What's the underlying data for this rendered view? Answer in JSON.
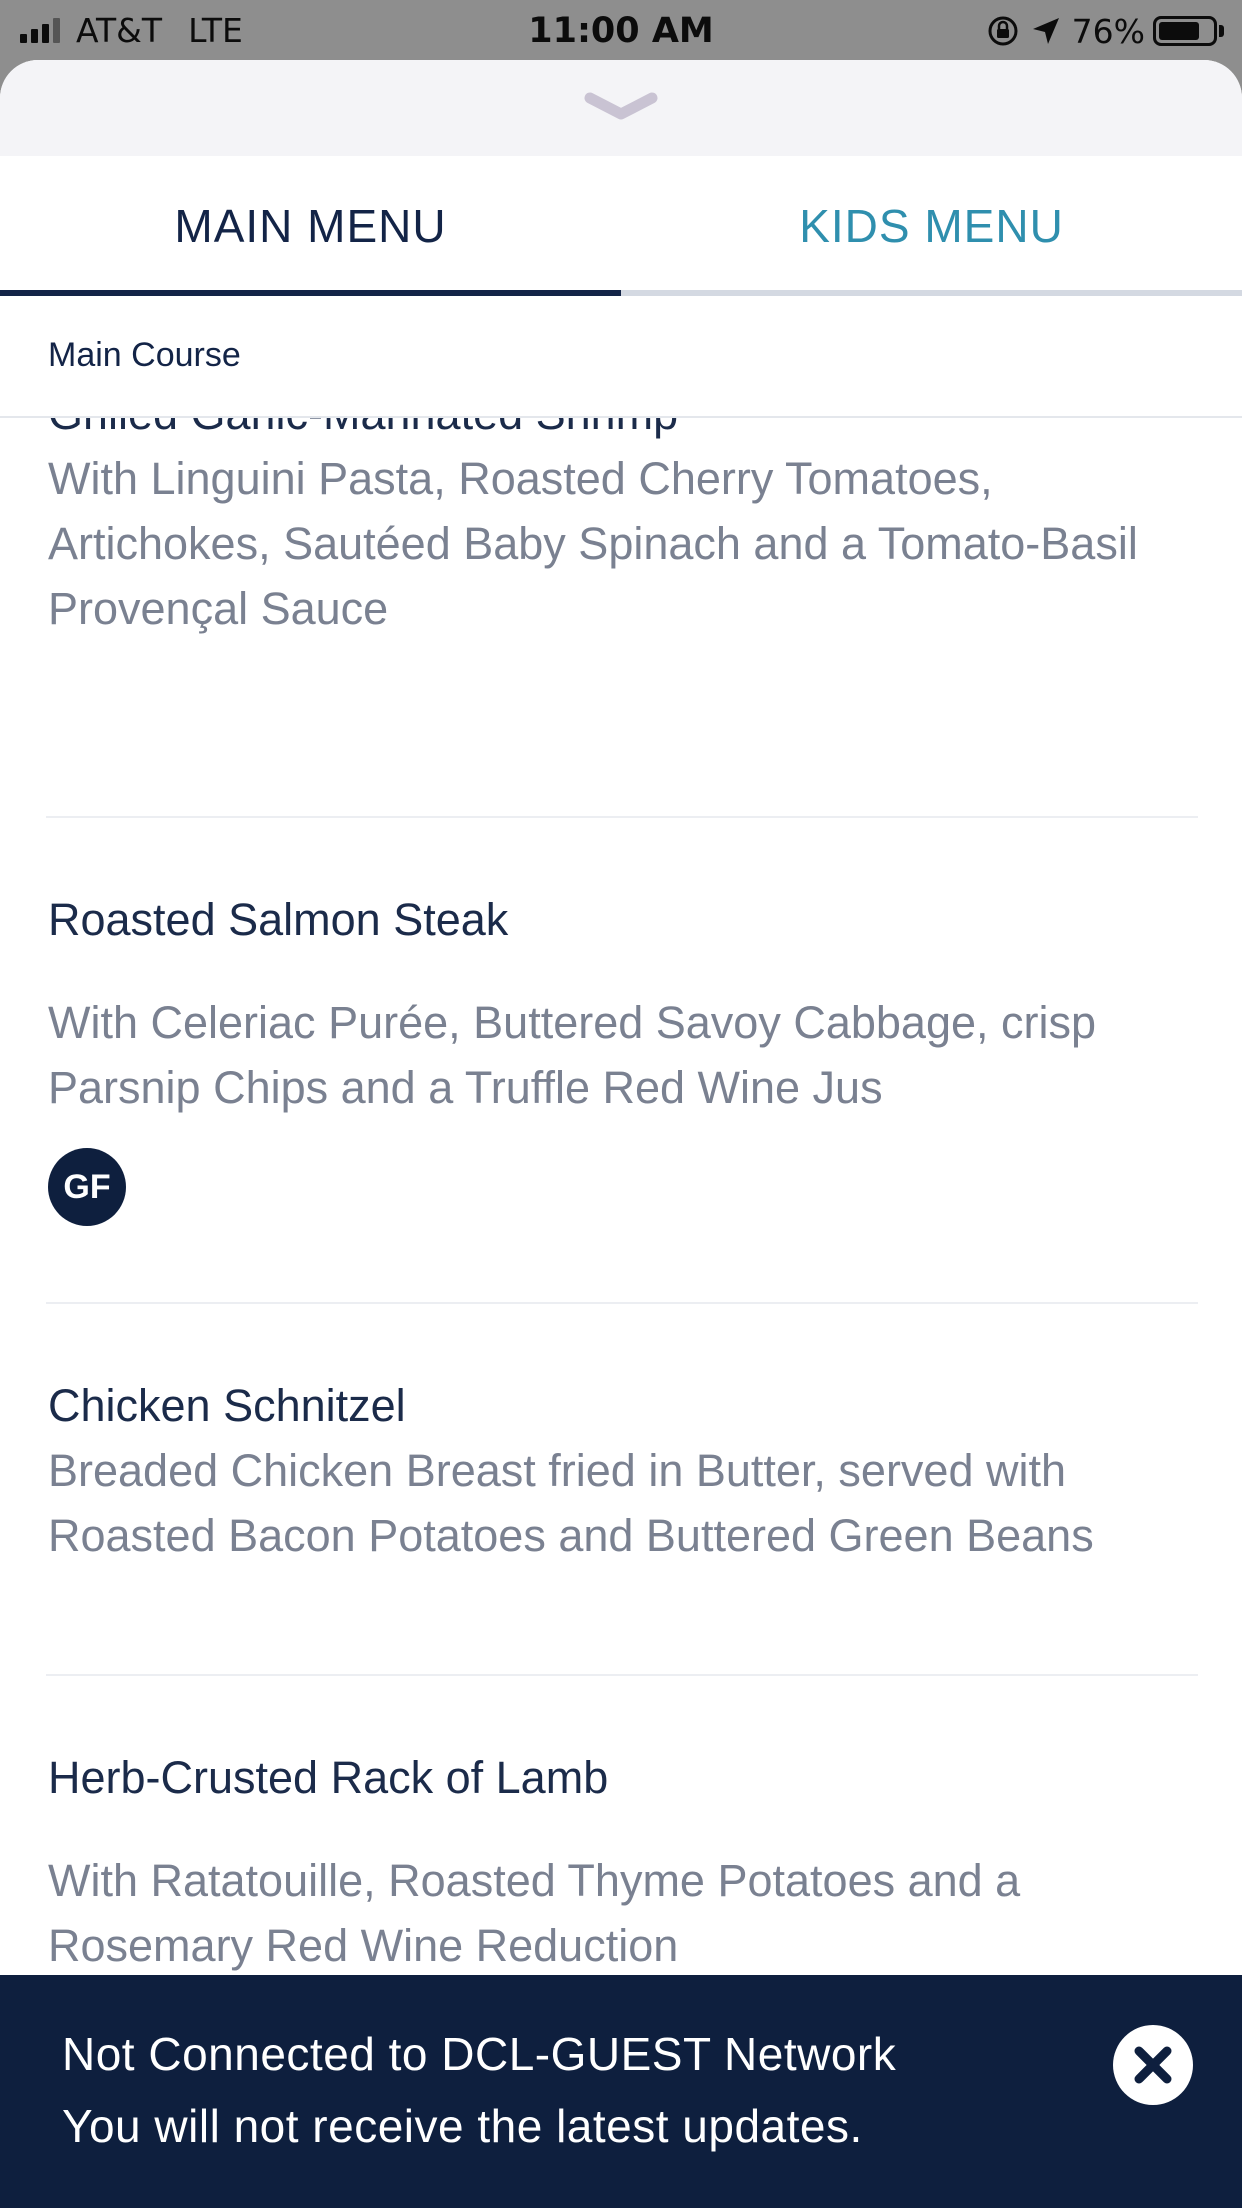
{
  "status_bar": {
    "carrier": "AT&T",
    "network": "LTE",
    "time": "11:00 AM",
    "battery": "76%",
    "battery_level": 0.76,
    "icons": [
      "signal-icon",
      "orientation-lock-icon",
      "location-arrow-icon",
      "battery-icon"
    ]
  },
  "sheet": {
    "handle_icon": "chevron-down-icon"
  },
  "tabs": {
    "main": "MAIN MENU",
    "kids": "KIDS MENU",
    "selected": "main"
  },
  "section": {
    "title": "Main Course"
  },
  "menu_items": [
    {
      "title": "Grilled Garlic-Marinated Shrimp",
      "description": "With Linguini Pasta, Roasted Cherry Tomatoes, Artichokes, Sautéed Baby Spinach and a Tomato-Basil Provençal Sauce"
    },
    {
      "title": "Roasted Salmon Steak",
      "description": "With Celeriac Purée, Buttered Savoy Cabbage, crisp Parsnip Chips and a Truffle Red Wine Jus",
      "badge": "GF"
    },
    {
      "title": "Chicken Schnitzel",
      "description": "Breaded Chicken Breast fried in Butter, served with Roasted Bacon Potatoes and Buttered Green Beans"
    },
    {
      "title": "Herb-Crusted Rack of Lamb",
      "description": "With Ratatouille, Roasted Thyme Potatoes and a Rosemary Red Wine Reduction"
    }
  ],
  "banner": {
    "line1": "Not Connected to DCL-GUEST Network",
    "line2": "You will not receive the latest updates.",
    "close_icon": "close-icon"
  },
  "colors": {
    "navy": "#132447",
    "accent_teal": "#2f8fae",
    "banner_bg": "#0e1f3e",
    "desc_gray": "#7a8191"
  }
}
